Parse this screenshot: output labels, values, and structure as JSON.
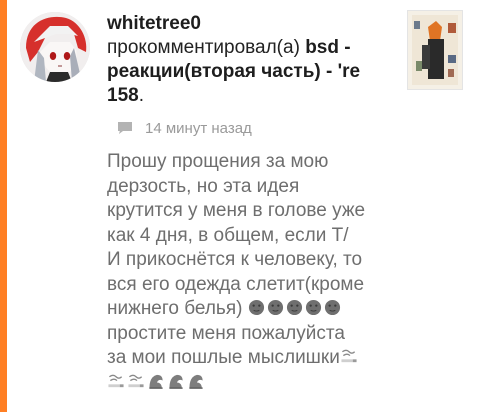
{
  "colors": {
    "accent": "#ff7f24",
    "text_dark": "#1e1e1e",
    "text_muted": "#9a9a9a",
    "comment_text": "#6e6e6e"
  },
  "notification": {
    "username": "whitetree0",
    "action": "прокомментировал(а)",
    "post_title_part1": "bsd -",
    "post_title_part2": "реакции(вторая часть) - 're",
    "post_title_part3": "158",
    "title_end": ".",
    "meta_icon": "comment-bubble-icon",
    "timestamp": "14 минут назад",
    "comment": {
      "line1": "Прошу прощения за мою",
      "line2": "дерзость, но эта идея",
      "line3": "крутится у меня в голове уже",
      "line4": "как  4 дня, в общем, если Т/",
      "line5": "И прикоснётся к человеку, то",
      "line6": "вся его одежда слетит(кроме",
      "line7": "нижнего белья)",
      "line8": "простите меня пожалуйста",
      "line9": "за мои пошлые мыслишки"
    },
    "emojis": {
      "moon_face": "new-moon-face-emoji",
      "smoking": "smoking-cigarette-emoji",
      "wave": "water-wave-emoji"
    }
  }
}
